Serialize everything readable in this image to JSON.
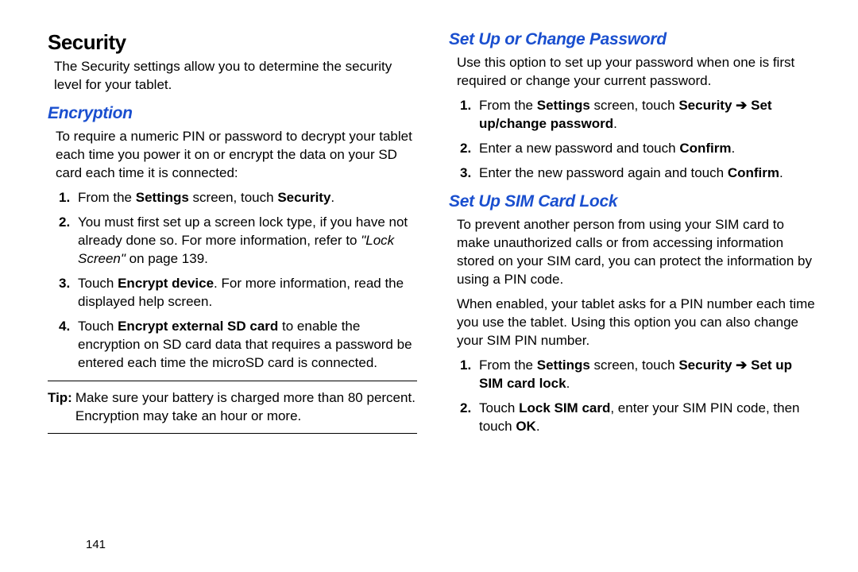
{
  "left": {
    "title": "Security",
    "intro": "The Security settings allow you to determine the security level for your tablet.",
    "encryption": {
      "heading": "Encryption",
      "body": "To require a numeric PIN or password to decrypt your tablet each time you power it on or encrypt the data on your SD card each time it is connected:",
      "steps": {
        "s1_a": "From the ",
        "s1_b": "Settings",
        "s1_c": " screen, touch ",
        "s1_d": "Security",
        "s1_e": ".",
        "s2_a": "You must first set up a screen lock type, if you have not already done so. For more information, refer to ",
        "s2_ref": "\"Lock Screen\"",
        "s2_b": " on page 139.",
        "s3_a": "Touch ",
        "s3_b": "Encrypt device",
        "s3_c": ". For more information, read the displayed help screen.",
        "s4_a": "Touch ",
        "s4_b": "Encrypt external SD card",
        "s4_c": " to enable the encryption on SD card data that requires a password be entered each time the microSD card is connected."
      },
      "tip_label": "Tip:",
      "tip_text": "Make sure your battery is charged more than 80 percent. Encryption may take an hour or more."
    },
    "page_number": "141"
  },
  "right": {
    "password": {
      "heading": "Set Up or Change Password",
      "body": "Use this option to set up your password when one is first required or change your current password.",
      "steps": {
        "s1_a": "From the ",
        "s1_b": "Settings",
        "s1_c": " screen, touch ",
        "s1_d": "Security",
        "s1_arrow": " ➔ ",
        "s1_e": "Set up/change password",
        "s1_f": ".",
        "s2_a": "Enter a new password and touch ",
        "s2_b": "Confirm",
        "s2_c": ".",
        "s3_a": "Enter the new password again and touch ",
        "s3_b": "Confirm",
        "s3_c": "."
      }
    },
    "simlock": {
      "heading": "Set Up SIM Card Lock",
      "body1": "To prevent another person from using your SIM card to make unauthorized calls or from accessing information stored on your SIM card, you can protect the information by using a PIN code.",
      "body2": "When enabled, your tablet asks for a PIN number each time you use the tablet. Using this option you can also change your SIM PIN number.",
      "steps": {
        "s1_a": "From the ",
        "s1_b": "Settings",
        "s1_c": " screen, touch ",
        "s1_d": "Security",
        "s1_arrow": " ➔ ",
        "s1_e": "Set up SIM card lock",
        "s1_f": ".",
        "s2_a": "Touch ",
        "s2_b": "Lock SIM card",
        "s2_c": ", enter your SIM PIN code, then touch ",
        "s2_d": "OK",
        "s2_e": "."
      }
    }
  }
}
